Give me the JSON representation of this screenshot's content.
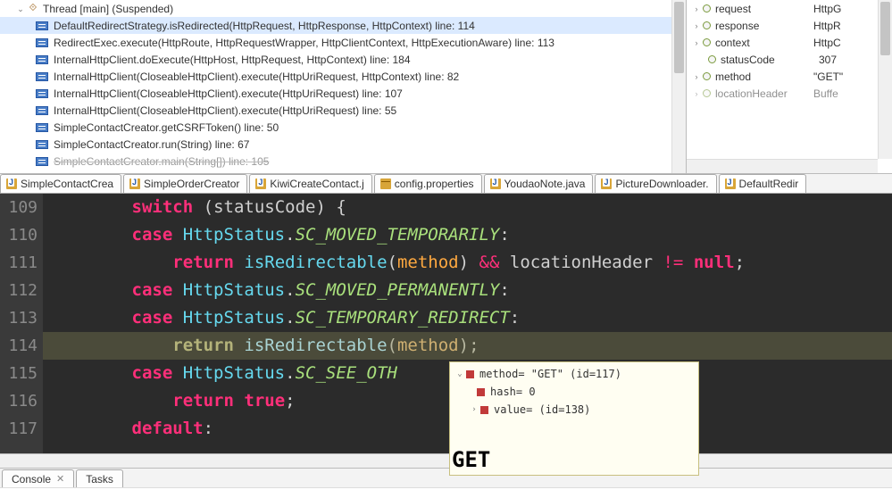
{
  "thread_header": "Thread [main] (Suspended)",
  "stack_frames": [
    "DefaultRedirectStrategy.isRedirected(HttpRequest, HttpResponse, HttpContext) line: 114",
    "RedirectExec.execute(HttpRoute, HttpRequestWrapper, HttpClientContext, HttpExecutionAware) line: 113",
    "InternalHttpClient.doExecute(HttpHost, HttpRequest, HttpContext) line: 184",
    "InternalHttpClient(CloseableHttpClient).execute(HttpUriRequest, HttpContext) line: 82",
    "InternalHttpClient(CloseableHttpClient).execute(HttpUriRequest) line: 107",
    "InternalHttpClient(CloseableHttpClient).execute(HttpUriRequest) line: 55",
    "SimpleContactCreator.getCSRFToken() line: 50",
    "SimpleContactCreator.run(String) line: 67",
    "SimpleContactCreator.main(String[]) line: 105"
  ],
  "variables": [
    {
      "name": "request",
      "value": "HttpG",
      "lvl": 0,
      "exp": true
    },
    {
      "name": "response",
      "value": "HttpR",
      "lvl": 0,
      "exp": true
    },
    {
      "name": "context",
      "value": "HttpC",
      "lvl": 0,
      "exp": true
    },
    {
      "name": "statusCode",
      "value": "307",
      "lvl": 1,
      "exp": false
    },
    {
      "name": "method",
      "value": "\"GET\"",
      "lvl": 0,
      "exp": true
    },
    {
      "name": "locationHeader",
      "value": "Buffe",
      "lvl": 0,
      "exp": true
    }
  ],
  "editor_tabs": [
    {
      "label": "SimpleContactCrea",
      "kind": "j"
    },
    {
      "label": "SimpleOrderCreator",
      "kind": "j"
    },
    {
      "label": "KiwiCreateContact.j",
      "kind": "j"
    },
    {
      "label": "config.properties",
      "kind": "p"
    },
    {
      "label": "YoudaoNote.java",
      "kind": "j"
    },
    {
      "label": "PictureDownloader.",
      "kind": "j"
    },
    {
      "label": "DefaultRedir",
      "kind": "j",
      "active": true
    }
  ],
  "line_start": 109,
  "hover": {
    "title": "method= \"GET\" (id=117)",
    "r1": "hash= 0",
    "r2": "value=  (id=138)",
    "big": "GET"
  },
  "bottom_tabs": [
    "Console",
    "Tasks"
  ]
}
